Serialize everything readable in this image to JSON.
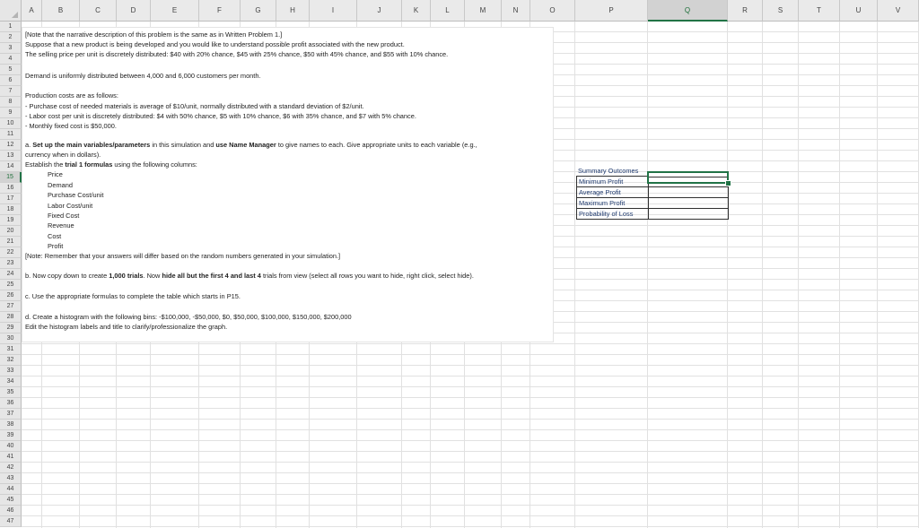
{
  "columns": [
    "A",
    "B",
    "C",
    "D",
    "E",
    "F",
    "G",
    "H",
    "I",
    "J",
    "K",
    "L",
    "M",
    "N",
    "O",
    "P",
    "Q",
    "R",
    "S",
    "T",
    "U",
    "V"
  ],
  "rows": [
    "1",
    "2",
    "3",
    "4",
    "5",
    "6",
    "7",
    "8",
    "9",
    "10",
    "11",
    "12",
    "13",
    "14",
    "15",
    "16",
    "17",
    "18",
    "19",
    "20",
    "21",
    "22",
    "23",
    "24",
    "25",
    "26",
    "27",
    "28",
    "29",
    "30",
    "31",
    "32",
    "33",
    "34",
    "35",
    "36",
    "37",
    "38",
    "39",
    "40",
    "41",
    "42",
    "43",
    "44",
    "45",
    "46",
    "47"
  ],
  "selected_column": "Q",
  "selected_row": "15",
  "instructions": [
    "[Note that the narrative description of this problem is the same as in Written Problem 1.]",
    "Suppose that a new product is being developed and you would like to understand possible profit associated with the new product.",
    "The selling price per unit is discretely distributed: $40 with 20% chance, $45 with 25% chance, $50 with 45% chance, and $55 with 10% chance.",
    "Demand is uniformly distributed between 4,000 and 6,000 customers per month.",
    "Production costs are as follows:",
    "- Purchase cost of needed materials is average of $10/unit, normally distributed with a standard deviation of $2/unit.",
    "- Labor cost per unit is discretely distributed: $4 with 50% chance, $5 with 10% chance, $6 with 35% chance, and $7 with 5% chance.",
    "- Monthly fixed cost is $50,000.",
    "a. ",
    "Set up the main variables/parameters",
    " in this simulation and ",
    "use Name Manager",
    " to give names to each. Give appropriate units to each variable (e.g.,",
    "currency when in dollars).",
    "Establish the ",
    "trial 1 formulas",
    " using the following columns:",
    "Price",
    "Demand",
    "Purchase Cost/unit",
    "Labor Cost/unit",
    "Fixed Cost",
    "Revenue",
    "Cost",
    "Profit",
    "[Note: Remember that your answers will differ based on the random numbers generated in your simulation.]",
    "b. Now copy down to create ",
    "1,000 trials",
    ". Now ",
    "hide all but the first 4 and last 4",
    " trials from view (select all rows you want to hide, right click, select hide).",
    "c. Use the appropriate formulas to complete the table which starts in P15.",
    "d. Create a histogram with the following bins: -$100,000, -$50,000, $0, $50,000, $100,000, $150,000, $200,000",
    "Edit the histogram labels and title to clarify/professionalize the graph."
  ],
  "summary": {
    "title": "Summary Outcomes",
    "rows": [
      {
        "label": "Minimum Profit",
        "value": ""
      },
      {
        "label": "Average Profit",
        "value": ""
      },
      {
        "label": "Maximum Profit",
        "value": ""
      },
      {
        "label": "Probability of Loss",
        "value": ""
      }
    ]
  }
}
